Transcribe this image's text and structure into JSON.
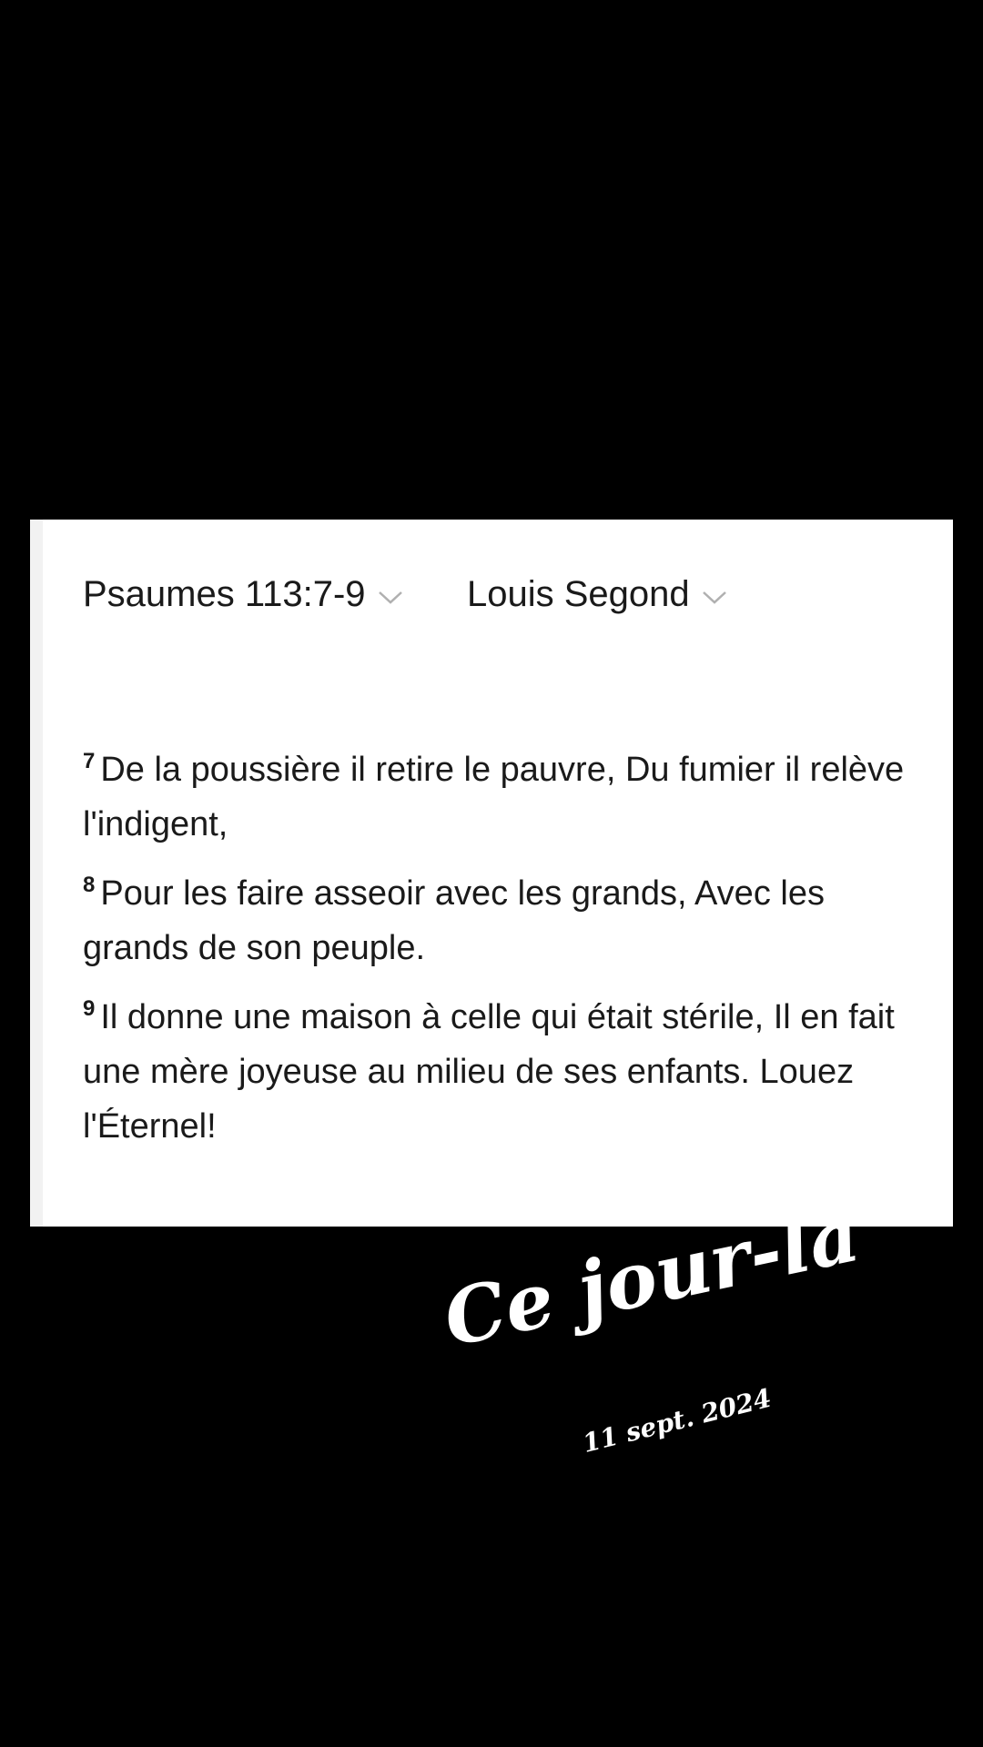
{
  "reference": {
    "book_label": "Psaumes 113:7-9",
    "version_label": "Louis Segond"
  },
  "verses": [
    {
      "number": "7",
      "text": "De la poussière il retire le pauvre, Du fumier il relève l'indigent,"
    },
    {
      "number": "8",
      "text": "Pour les faire asseoir avec les grands, Avec les grands de son peuple."
    },
    {
      "number": "9",
      "text": "Il donne une maison à celle qui était stérile, Il en fait une mère joyeuse au milieu de ses enfants. Louez l'Éternel!"
    }
  ],
  "overlay": {
    "title": "Ce jour-là",
    "date": "11 sept. 2024"
  },
  "icons": {
    "book_chevron": "chevron-down-icon",
    "version_chevron": "chevron-down-icon"
  },
  "colors": {
    "background": "#000000",
    "card": "#ffffff",
    "text": "#1a1a1a",
    "chevron": "#b0b0b0"
  }
}
